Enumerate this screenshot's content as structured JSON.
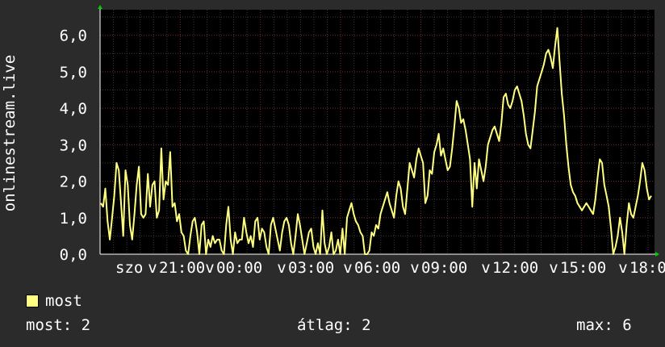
{
  "chart_data": {
    "type": "line",
    "ylabel": "onlinestream.live",
    "y_ticks": [
      "0,0",
      "1,0",
      "2,0",
      "3,0",
      "4,0",
      "5,0",
      "6,0"
    ],
    "ylim": [
      0,
      6.7
    ],
    "x_ticks": [
      "szo",
      "21:00",
      "00:00",
      "03:00",
      "06:00",
      "09:00",
      "12:00",
      "15:00",
      "18:00"
    ],
    "x_tick_marker": "v",
    "grid": true,
    "series": [
      {
        "name": "most",
        "color": "#ffff80",
        "x_start": "17:00",
        "step_minutes": 5,
        "values": [
          1.4,
          1.3,
          1.8,
          0.9,
          0.4,
          1.0,
          1.6,
          2.5,
          2.3,
          1.4,
          0.5,
          2.3,
          1.9,
          0.8,
          0.4,
          1.1,
          1.9,
          2.4,
          1.1,
          1.0,
          1.1,
          2.2,
          1.3,
          1.9,
          2.0,
          1.0,
          1.2,
          2.9,
          1.5,
          2.0,
          1.9,
          2.8,
          1.3,
          1.4,
          0.9,
          1.1,
          0.6,
          0.5,
          0.1,
          0.0,
          0.5,
          0.9,
          1.0,
          0.6,
          0.0,
          0.8,
          0.9,
          0.0,
          0.4,
          0.2,
          0.5,
          0.3,
          0.4,
          0.4,
          0.1,
          0.0,
          0.8,
          1.3,
          0.4,
          0.0,
          0.6,
          0.3,
          0.4,
          0.4,
          1.0,
          0.6,
          0.3,
          0.5,
          0.2,
          0.9,
          1.0,
          0.4,
          0.7,
          0.6,
          0.2,
          0.0,
          0.8,
          1.0,
          0.7,
          0.4,
          0.1,
          0.6,
          0.9,
          1.0,
          0.8,
          0.3,
          0.0,
          0.5,
          1.1,
          0.8,
          0.4,
          0.0,
          0.3,
          0.6,
          0.7,
          0.2,
          0.0,
          0.3,
          0.0,
          1.2,
          0.3,
          0.0,
          0.2,
          0.6,
          0.0,
          0.1,
          0.4,
          0.0,
          0.7,
          0.0,
          1.0,
          1.2,
          1.4,
          1.1,
          0.9,
          0.8,
          0.6,
          0.5,
          0.0,
          0.0,
          0.1,
          0.6,
          0.5,
          0.8,
          0.7,
          1.1,
          1.3,
          1.5,
          1.7,
          1.4,
          1.2,
          1.0,
          1.6,
          2.0,
          1.8,
          1.3,
          1.1,
          1.8,
          2.5,
          2.3,
          2.1,
          2.6,
          2.9,
          2.7,
          2.5,
          1.4,
          1.6,
          2.3,
          2.2,
          2.8,
          3.0,
          3.3,
          2.7,
          2.9,
          2.6,
          2.3,
          2.4,
          2.9,
          3.5,
          4.2,
          4.0,
          3.6,
          3.7,
          3.4,
          3.0,
          2.6,
          1.3,
          2.5,
          1.8,
          2.6,
          2.3,
          2.0,
          2.4,
          3.0,
          3.2,
          3.4,
          3.5,
          3.3,
          3.1,
          3.6,
          4.3,
          4.4,
          4.1,
          4.0,
          4.2,
          4.5,
          4.6,
          4.4,
          4.2,
          3.8,
          3.3,
          3.0,
          2.9,
          3.4,
          3.9,
          4.6,
          4.8,
          5.0,
          5.2,
          5.5,
          5.6,
          5.4,
          5.1,
          5.7,
          6.2,
          5.3,
          4.4,
          3.8,
          3.0,
          2.4,
          1.9,
          1.7,
          1.6,
          1.4,
          1.3,
          1.2,
          1.3,
          1.4,
          1.3,
          1.2,
          1.1,
          1.5,
          2.1,
          2.6,
          2.5,
          1.9,
          1.6,
          1.3,
          0.7,
          0.0,
          0.2,
          0.5,
          1.0,
          0.6,
          0.0,
          0.8,
          1.4,
          1.1,
          1.0,
          1.3,
          1.6,
          2.0,
          2.5,
          2.3,
          1.8,
          1.5,
          1.6
        ]
      }
    ]
  },
  "legend": {
    "label": "most",
    "color": "#ffff80"
  },
  "stats": {
    "current": "most: 2",
    "average": "átlag: 2",
    "max": "max: 6"
  }
}
